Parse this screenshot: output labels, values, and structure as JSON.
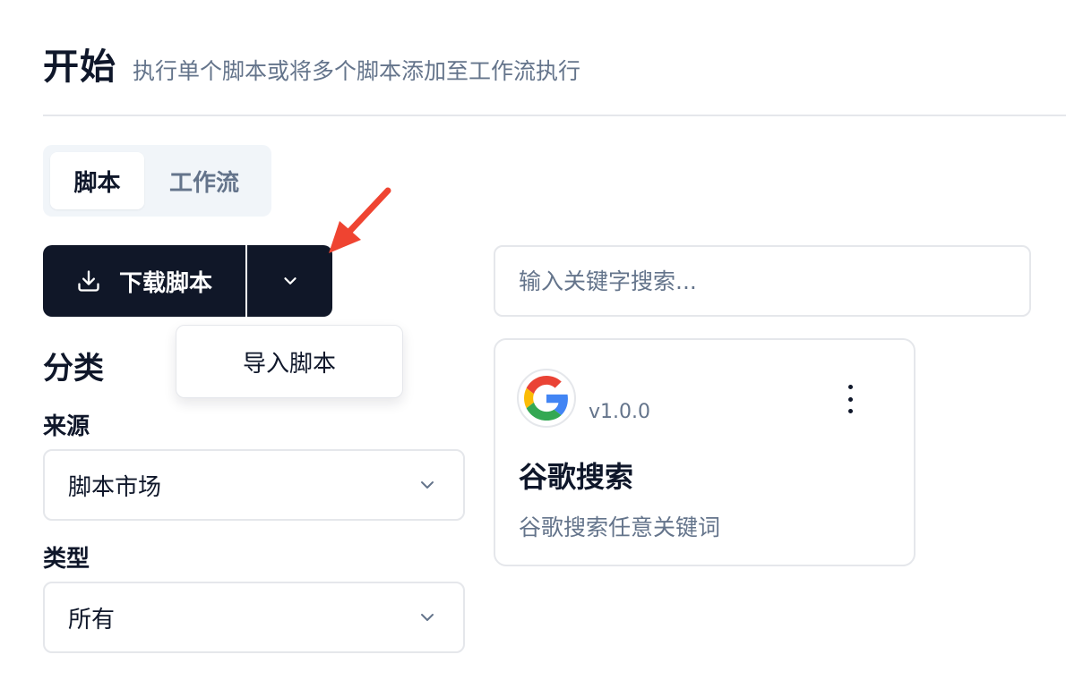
{
  "header": {
    "title": "开始",
    "subtitle": "执行单个脚本或将多个脚本添加至工作流执行"
  },
  "tabs": [
    {
      "label": "脚本",
      "active": true
    },
    {
      "label": "工作流",
      "active": false
    }
  ],
  "toolbar": {
    "download_label": "下载脚本",
    "download_icon": "download-icon",
    "toggle_icon": "chevron-down-icon",
    "menu": [
      {
        "label": "导入脚本"
      }
    ]
  },
  "filters": {
    "section_title": "分类",
    "source": {
      "label": "来源",
      "value": "脚本市场"
    },
    "type": {
      "label": "类型",
      "value": "所有"
    }
  },
  "search": {
    "placeholder": "输入关键字搜索..."
  },
  "scripts": [
    {
      "icon": "google-logo",
      "version": "v1.0.0",
      "title": "谷歌搜索",
      "description": "谷歌搜索任意关键词"
    }
  ],
  "colors": {
    "primary": "#101728",
    "muted_text": "#64748b",
    "border": "#e5e7eb",
    "tab_bg": "#f1f5f9",
    "annotation_arrow": "#ef4431"
  }
}
